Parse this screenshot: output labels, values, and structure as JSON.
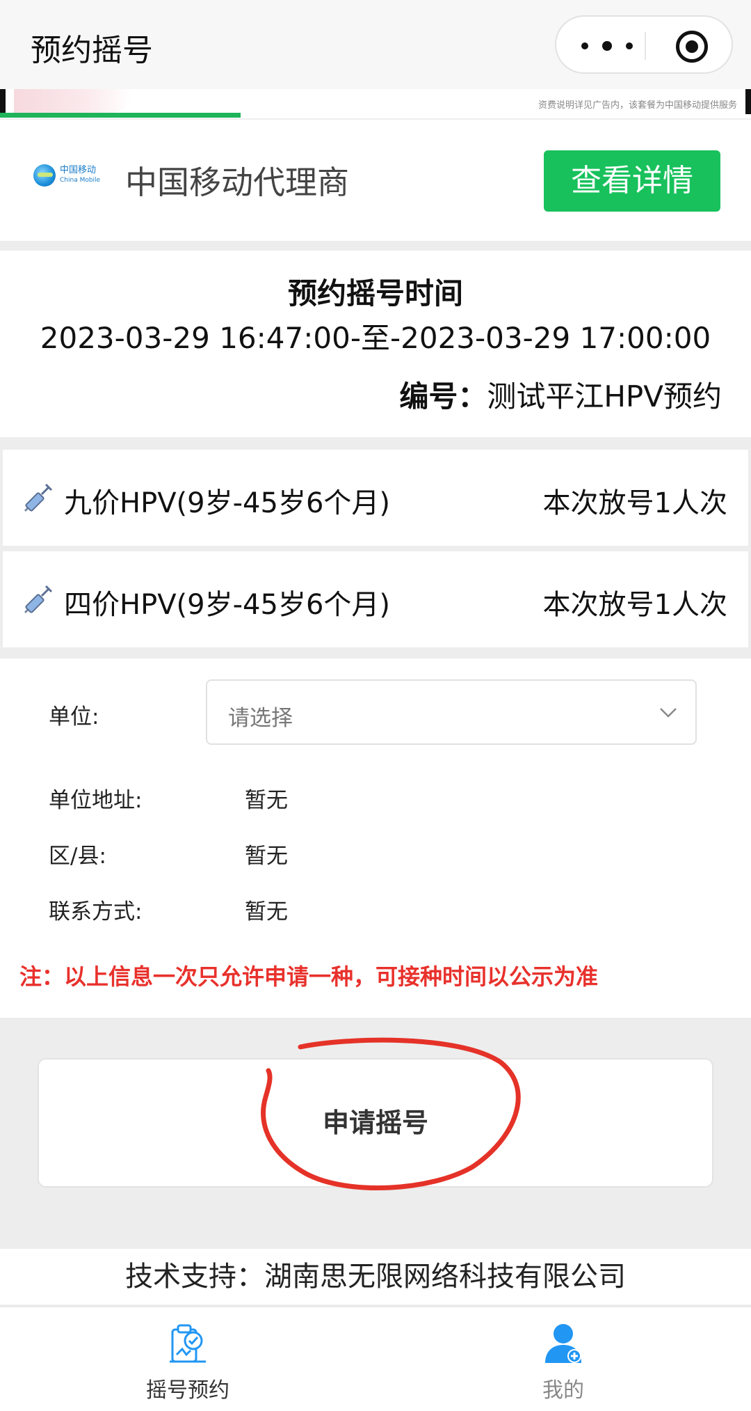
{
  "nav": {
    "title": "预约摇号"
  },
  "banner": {
    "note": "资费说明详见广告内，该套餐为中国移动提供服务"
  },
  "agent": {
    "logo_cn": "中国移动",
    "logo_en": "China Mobile",
    "name": "中国移动代理商",
    "detail_button": "查看详情",
    "button_color": "#18c15c"
  },
  "schedule": {
    "title": "预约摇号时间",
    "range": "2023-03-29 16:47:00-至-2023-03-29 17:00:00",
    "serial_label": "编号：",
    "serial_value": "测试平江HPV预约"
  },
  "vaccines": [
    {
      "icon": "syringe-icon",
      "name": "九价HPV(9岁-45岁6个月)",
      "quota": "本次放号1人次"
    },
    {
      "icon": "syringe-icon",
      "name": "四价HPV(9岁-45岁6个月)",
      "quota": "本次放号1人次"
    }
  ],
  "form": {
    "unit_label": "单位:",
    "unit_placeholder": "请选择",
    "address_label": "单位地址:",
    "address_value": "暂无",
    "district_label": "区/县:",
    "district_value": "暂无",
    "contact_label": "联系方式:",
    "contact_value": "暂无",
    "notice": "注：以上信息一次只允许申请一种，可接种时间以公示为准",
    "notice_color": "#e8312c"
  },
  "apply_button": "申请摇号",
  "support": "技术支持：湖南思无限网络科技有限公司",
  "tabs": [
    {
      "label": "摇号预约",
      "icon": "lottery-clipboard-icon",
      "active": true
    },
    {
      "label": "我的",
      "icon": "user-profile-icon",
      "active": false
    }
  ],
  "colors": {
    "accent_blue": "#2196f3",
    "annotation_red": "#e53228"
  }
}
